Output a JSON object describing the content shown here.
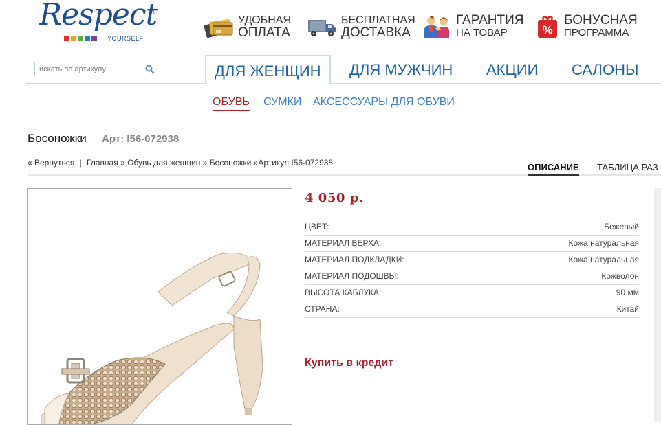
{
  "logo": {
    "text": "Respect",
    "sub": "YOURSELF",
    "reg": "®",
    "stripe_colors": [
      "#e8312d",
      "#f6a21c",
      "#5bb046",
      "#2b7bc2",
      "#7a3e98"
    ]
  },
  "features": [
    {
      "icon": "credit-card-icon",
      "line1": "УДОБНАЯ",
      "line2": "ОПЛАТА"
    },
    {
      "icon": "delivery-truck-icon",
      "line1": "БЕСПЛАТНАЯ",
      "line2": "ДОСТАВКА"
    },
    {
      "icon": "guarantee-people-icon",
      "line1": "ГАРАНТИЯ",
      "line2": "НА ТОВАР"
    },
    {
      "icon": "percent-gift-icon",
      "line1": "БОНУСНАЯ",
      "line2": "ПРОГРАММА"
    }
  ],
  "search": {
    "placeholder": "искать по артикулу",
    "icon": "search-icon"
  },
  "nav": {
    "items": [
      {
        "label": "ДЛЯ ЖЕНЩИН",
        "active": true
      },
      {
        "label": "ДЛЯ МУЖЧИН",
        "active": false
      },
      {
        "label": "АКЦИИ",
        "active": false
      },
      {
        "label": "САЛОНЫ",
        "active": false
      }
    ]
  },
  "subnav": {
    "items": [
      {
        "label": "ОБУВЬ",
        "active": true
      },
      {
        "label": "СУМКИ",
        "active": false
      },
      {
        "label": "АКСЕССУАРЫ ДЛЯ ОБУВИ",
        "active": false
      }
    ]
  },
  "product": {
    "title": "Босоножки",
    "article": "Арт: I56-072938",
    "price": "4 050 р.",
    "credit_link": "Купить в кредит",
    "specs": [
      {
        "key": "ЦВЕТ:",
        "value": "Бежевый"
      },
      {
        "key": "МАТЕРИАЛ ВЕРХА:",
        "value": "Кожа натуральная"
      },
      {
        "key": "МАТЕРИАЛ ПОДКЛАДКИ:",
        "value": "Кожа натуральная"
      },
      {
        "key": "МАТЕРИАЛ ПОДОШВЫ:",
        "value": "Кожволон"
      },
      {
        "key": "ВЫСОТА КАБЛУКА:",
        "value": "90 мм"
      },
      {
        "key": "СТРАНА:",
        "value": "Китай"
      }
    ]
  },
  "breadcrumb": {
    "back": "« Вернуться",
    "divider": "|",
    "home": "Главная",
    "arrow": "»",
    "category": "Обувь для женщин",
    "subcategory": "Босоножки",
    "current": "Артикул I56-072938"
  },
  "tabs": {
    "description": "ОПИСАНИЕ",
    "sizes": "ТАБЛИЦА РАЗ"
  },
  "colors": {
    "brand_blue": "#1f63a8",
    "accent_red": "#a5232b"
  }
}
